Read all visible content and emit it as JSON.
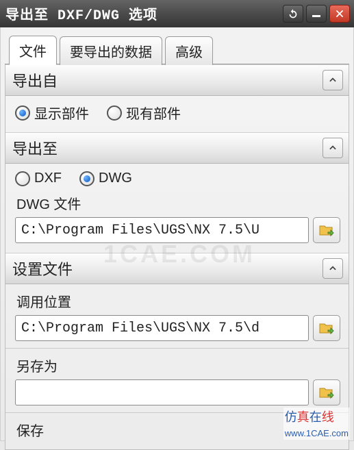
{
  "window": {
    "title": "导出至 DXF/DWG 选项"
  },
  "tabs": [
    {
      "label": "文件",
      "active": true
    },
    {
      "label": "要导出的数据",
      "active": false
    },
    {
      "label": "高级",
      "active": false
    }
  ],
  "sections": {
    "export_from": {
      "title": "导出自",
      "options": [
        {
          "label": "显示部件",
          "checked": true
        },
        {
          "label": "现有部件",
          "checked": false
        }
      ]
    },
    "export_to": {
      "title": "导出至",
      "format_options": [
        {
          "label": "DXF",
          "checked": false
        },
        {
          "label": "DWG",
          "checked": true
        }
      ],
      "file_label": "DWG 文件",
      "file_path": "C:\\Program Files\\UGS\\NX 7.5\\U"
    },
    "settings_file": {
      "title": "设置文件",
      "call_location_label": "调用位置",
      "call_location_path": "C:\\Program Files\\UGS\\NX 7.5\\d",
      "save_as_label": "另存为",
      "save_as_path": "",
      "save_label": "保存"
    }
  },
  "watermark": "1CAE.COM",
  "footer": {
    "brand_cn": "仿真在线",
    "url": "www.1CAE.com"
  }
}
